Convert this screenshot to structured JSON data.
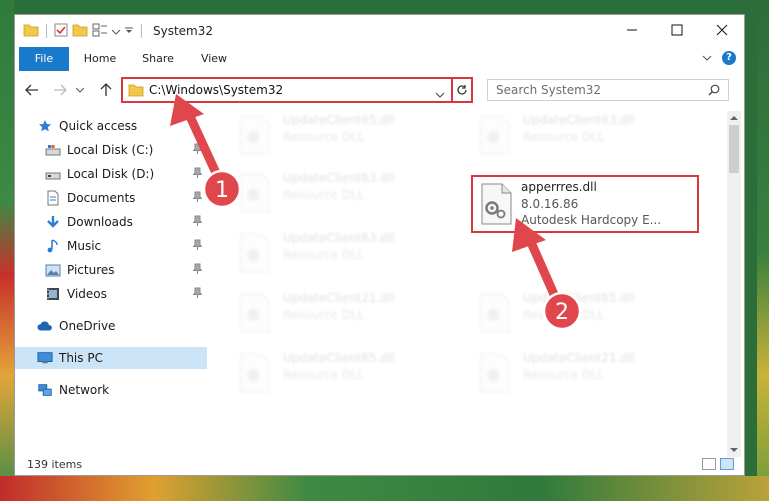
{
  "window": {
    "title": "System32"
  },
  "ribbon": {
    "tabs": [
      "File",
      "Home",
      "Share",
      "View"
    ]
  },
  "address": {
    "path": "C:\\Windows\\System32"
  },
  "search": {
    "placeholder": "Search System32"
  },
  "nav": {
    "items": [
      {
        "label": "Quick access",
        "icon": "star-icon",
        "pinned": false
      },
      {
        "label": "Local Disk (C:)",
        "icon": "drive-icon",
        "pinned": true
      },
      {
        "label": "Local Disk (D:)",
        "icon": "drive-icon",
        "pinned": true
      },
      {
        "label": "Documents",
        "icon": "documents-icon",
        "pinned": true
      },
      {
        "label": "Downloads",
        "icon": "download-icon",
        "pinned": true
      },
      {
        "label": "Music",
        "icon": "music-icon",
        "pinned": true
      },
      {
        "label": "Pictures",
        "icon": "pictures-icon",
        "pinned": true
      },
      {
        "label": "Videos",
        "icon": "videos-icon",
        "pinned": true
      },
      {
        "label": "OneDrive",
        "icon": "cloud-icon",
        "pinned": false
      },
      {
        "label": "This PC",
        "icon": "computer-icon",
        "pinned": false,
        "selected": true
      },
      {
        "label": "Network",
        "icon": "network-icon",
        "pinned": false
      }
    ]
  },
  "files": {
    "faded": [
      {
        "name": "UpdateClient65.dll",
        "desc": "Resource DLL"
      },
      {
        "name": "UpdateClient63.dll",
        "desc": "Resource DLL"
      },
      {
        "name": "UpdateClient63.dll",
        "desc": "Resource DLL"
      },
      {
        "name": "UpdateClient63.dll",
        "desc": "Resource DLL"
      },
      {
        "name": "UpdateClient21.dll",
        "desc": "Resource DLL"
      },
      {
        "name": "UpdateClient65.dll",
        "desc": "Resource DLL"
      },
      {
        "name": "UpdateClient65.dll",
        "desc": "Resource DLL"
      },
      {
        "name": "UpdateClient21.dll",
        "desc": "Resource DLL"
      }
    ],
    "highlighted": {
      "name": "apperrres.dll",
      "version": "8.0.16.86",
      "desc": "Autodesk Hardcopy E..."
    }
  },
  "status": {
    "count": "139 items"
  },
  "annotations": {
    "step1": "1",
    "step2": "2"
  },
  "colors": {
    "accent": "#1979ca",
    "highlight": "#d9363e",
    "arrow": "#e0474c"
  }
}
